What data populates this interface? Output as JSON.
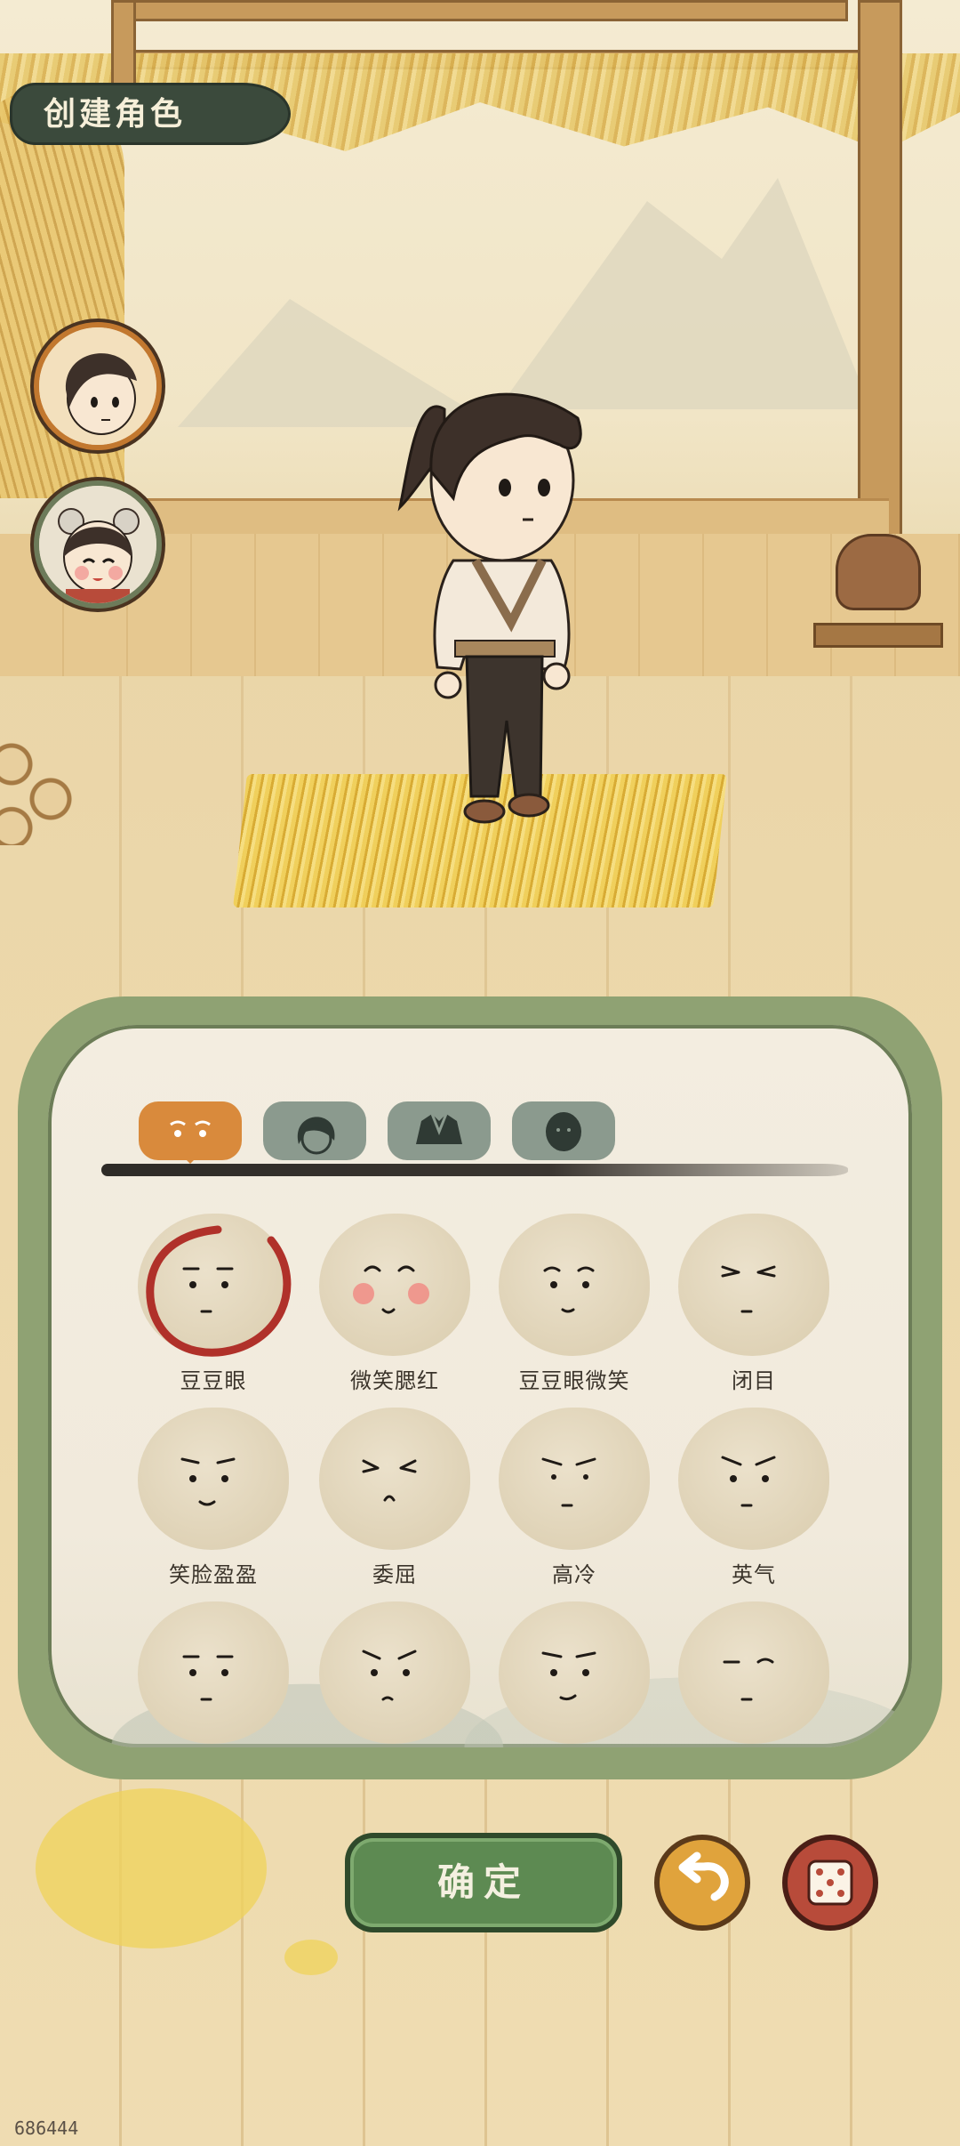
{
  "header": {
    "title": "创建角色"
  },
  "avatars": [
    {
      "name": "male-avatar",
      "selected": true
    },
    {
      "name": "female-avatar",
      "selected": false
    }
  ],
  "tabs": [
    {
      "icon": "eyes-icon",
      "active": true
    },
    {
      "icon": "hair-icon",
      "active": false
    },
    {
      "icon": "clothes-icon",
      "active": false
    },
    {
      "icon": "face-shape-icon",
      "active": false
    }
  ],
  "faces": [
    {
      "label": "豆豆眼",
      "selected": true
    },
    {
      "label": "微笑腮红",
      "selected": false
    },
    {
      "label": "豆豆眼微笑",
      "selected": false
    },
    {
      "label": "闭目",
      "selected": false
    },
    {
      "label": "笑脸盈盈",
      "selected": false
    },
    {
      "label": "委屈",
      "selected": false
    },
    {
      "label": "高冷",
      "selected": false
    },
    {
      "label": "英气",
      "selected": false
    },
    {
      "label": "",
      "selected": false
    },
    {
      "label": "",
      "selected": false
    },
    {
      "label": "",
      "selected": false
    },
    {
      "label": "",
      "selected": false
    }
  ],
  "actions": {
    "confirm_label": "确定",
    "undo_icon": "undo-icon",
    "random_icon": "dice-icon"
  },
  "colors": {
    "accent": "#d98a3c",
    "confirm": "#5d8a52",
    "panel_border": "#8fa273",
    "dice": "#b84b3a"
  },
  "watermark": "686444"
}
